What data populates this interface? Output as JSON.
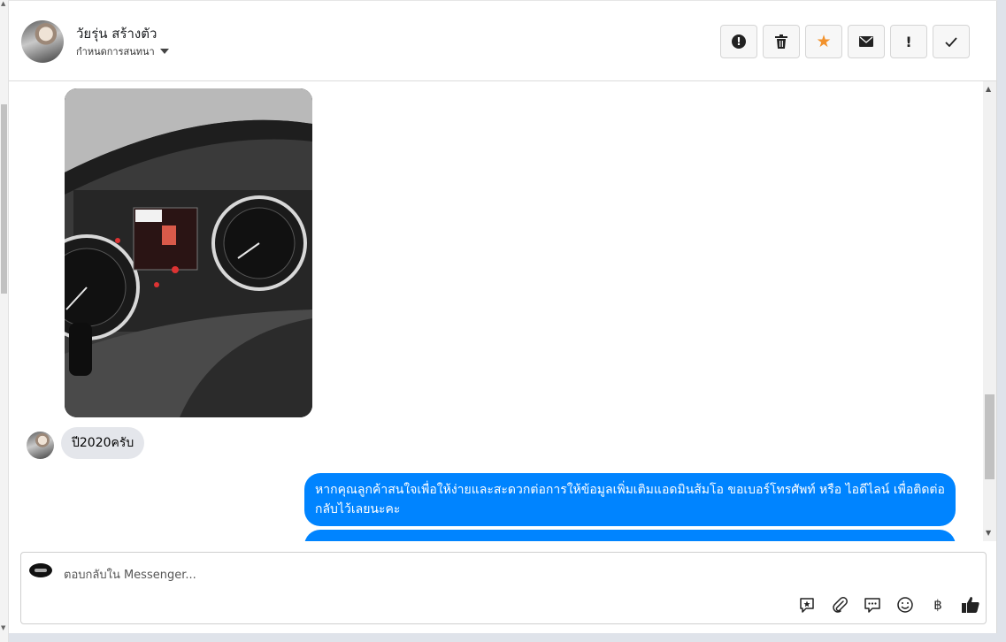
{
  "header": {
    "contact_name": "วัยรุ่น สร้างตัว",
    "subtitle": "กำหนดการสนทนา",
    "actions": [
      "alert-icon",
      "trash-icon",
      "star-icon",
      "mail-icon",
      "exclamation-icon",
      "check-icon"
    ],
    "star_color": "#f2922c",
    "exclamation_label": "!"
  },
  "messages": [
    {
      "from": "contact",
      "type": "image",
      "icon": "car-dashboard-photo"
    },
    {
      "from": "contact",
      "type": "text",
      "text": "ปี2020ครับ"
    },
    {
      "from": "page",
      "type": "text",
      "text": "หากคุณลูกค้าสนใจเพื่อให้ง่ายและสะดวกต่อการให้ข้อมูลเพิ่มเติมแอดมินส้มโอ ขอเบอร์โทรศัพท์ หรือ ไอดีไลน์ เพื่อติดต่อกลับไว้เลยนะคะ"
    }
  ],
  "composer": {
    "placeholder": "ตอบกลับใน Messenger...",
    "tools": [
      "saved-reply-icon",
      "attachment-icon",
      "chat-icon",
      "emoji-icon",
      "baht-icon",
      "thumbs-up-icon"
    ],
    "baht_symbol": "฿"
  },
  "colors": {
    "outgoing_bubble": "#0084ff",
    "incoming_bubble": "#e4e6eb"
  }
}
